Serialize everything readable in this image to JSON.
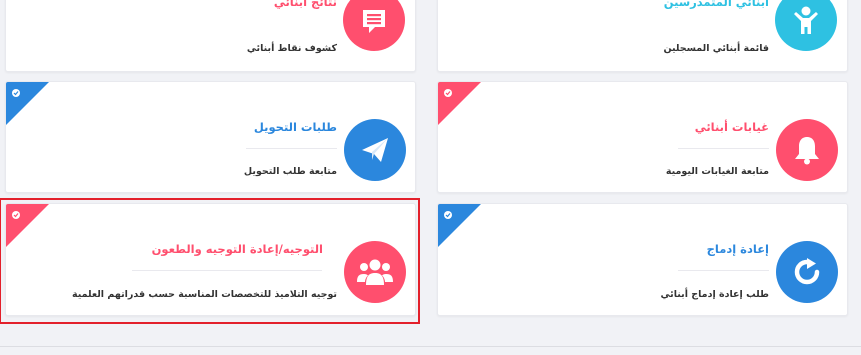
{
  "colors": {
    "pink": "#ff4f6e",
    "blue": "#2b87dd",
    "cyan": "#2ec1e2",
    "focus_red": "#e3202b"
  },
  "cards": {
    "results": {
      "title": "نتائج أبنائي",
      "desc": "كشوف نقاط أبنائي",
      "icon": "report-card-icon"
    },
    "enrolled": {
      "title": "أبنائي المتمدرسين",
      "desc": "قائمة أبنائي المسجلين",
      "icon": "child-icon"
    },
    "transfer": {
      "title": "طلبات التحويل",
      "desc": "متابعة طلب التحويل",
      "icon": "paper-plane-icon"
    },
    "absences": {
      "title": "غيابات أبنائي",
      "desc": "متابعة الغيابات اليومية",
      "icon": "bell-icon"
    },
    "orientation": {
      "title": "التوجيه/إعادة التوجيه والطعون",
      "desc": "توجيه التلاميذ للتخصصات المناسبة حسب قدراتهم العلمية",
      "icon": "users-group-icon"
    },
    "reintegration": {
      "title": "إعادة إدماج",
      "desc": "طلب إعادة إدماج أبنائي",
      "icon": "refresh-icon"
    }
  }
}
